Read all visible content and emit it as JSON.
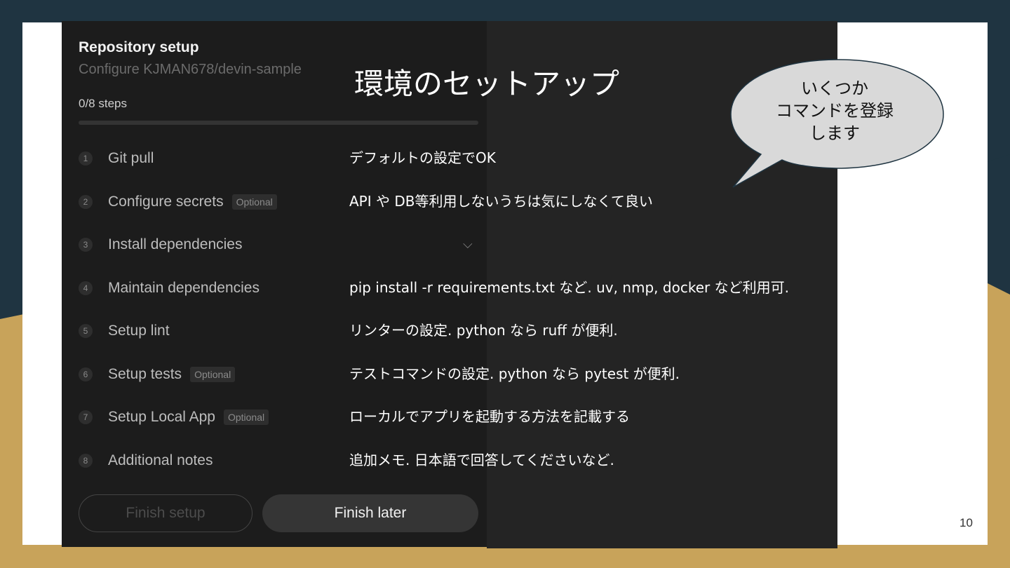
{
  "colors": {
    "background": "#1f3441",
    "gold": "#c8a35a",
    "slide": "#ffffff",
    "screenshot": "#1c1c1c",
    "overlay": "#242424",
    "accent": "#6aa0ff"
  },
  "screenshot": {
    "title": "Repository setup",
    "subtitle": "Configure KJMAN678/devin-sample",
    "steps_progress": "0/8 steps",
    "progress_fraction": 0,
    "steps": [
      {
        "num": "1",
        "label": "Git pull",
        "badge": ""
      },
      {
        "num": "2",
        "label": "Configure secrets",
        "badge": "Optional"
      },
      {
        "num": "3",
        "label": "Install dependencies",
        "badge": ""
      },
      {
        "num": "4",
        "label": "Maintain dependencies",
        "badge": ""
      },
      {
        "num": "5",
        "label": "Setup lint",
        "badge": ""
      },
      {
        "num": "6",
        "label": "Setup tests",
        "badge": "Optional"
      },
      {
        "num": "7",
        "label": "Setup Local App",
        "badge": "Optional"
      },
      {
        "num": "8",
        "label": "Additional notes",
        "badge": ""
      }
    ],
    "chevron_icon": "chevron-down-icon",
    "finish_setup_label": "Finish setup",
    "finish_later_label": "Finish later"
  },
  "slide": {
    "title": "環境のセットアップ",
    "notes": [
      "デフォルトの設定でOK",
      "API や DB等利用しないうちは気にしなくて良い",
      "",
      "pip install -r requirements.txt など. uv, nmp, docker など利用可.",
      "リンターの設定. python なら ruff が便利.",
      "テストコマンドの設定. python なら pytest が便利.",
      "ローカルでアプリを起動する方法を記載する",
      "追加メモ. 日本語で回答してくださいなど."
    ],
    "callout": [
      "いくつか",
      "コマンドを登録",
      "します"
    ],
    "page_number": "10"
  }
}
